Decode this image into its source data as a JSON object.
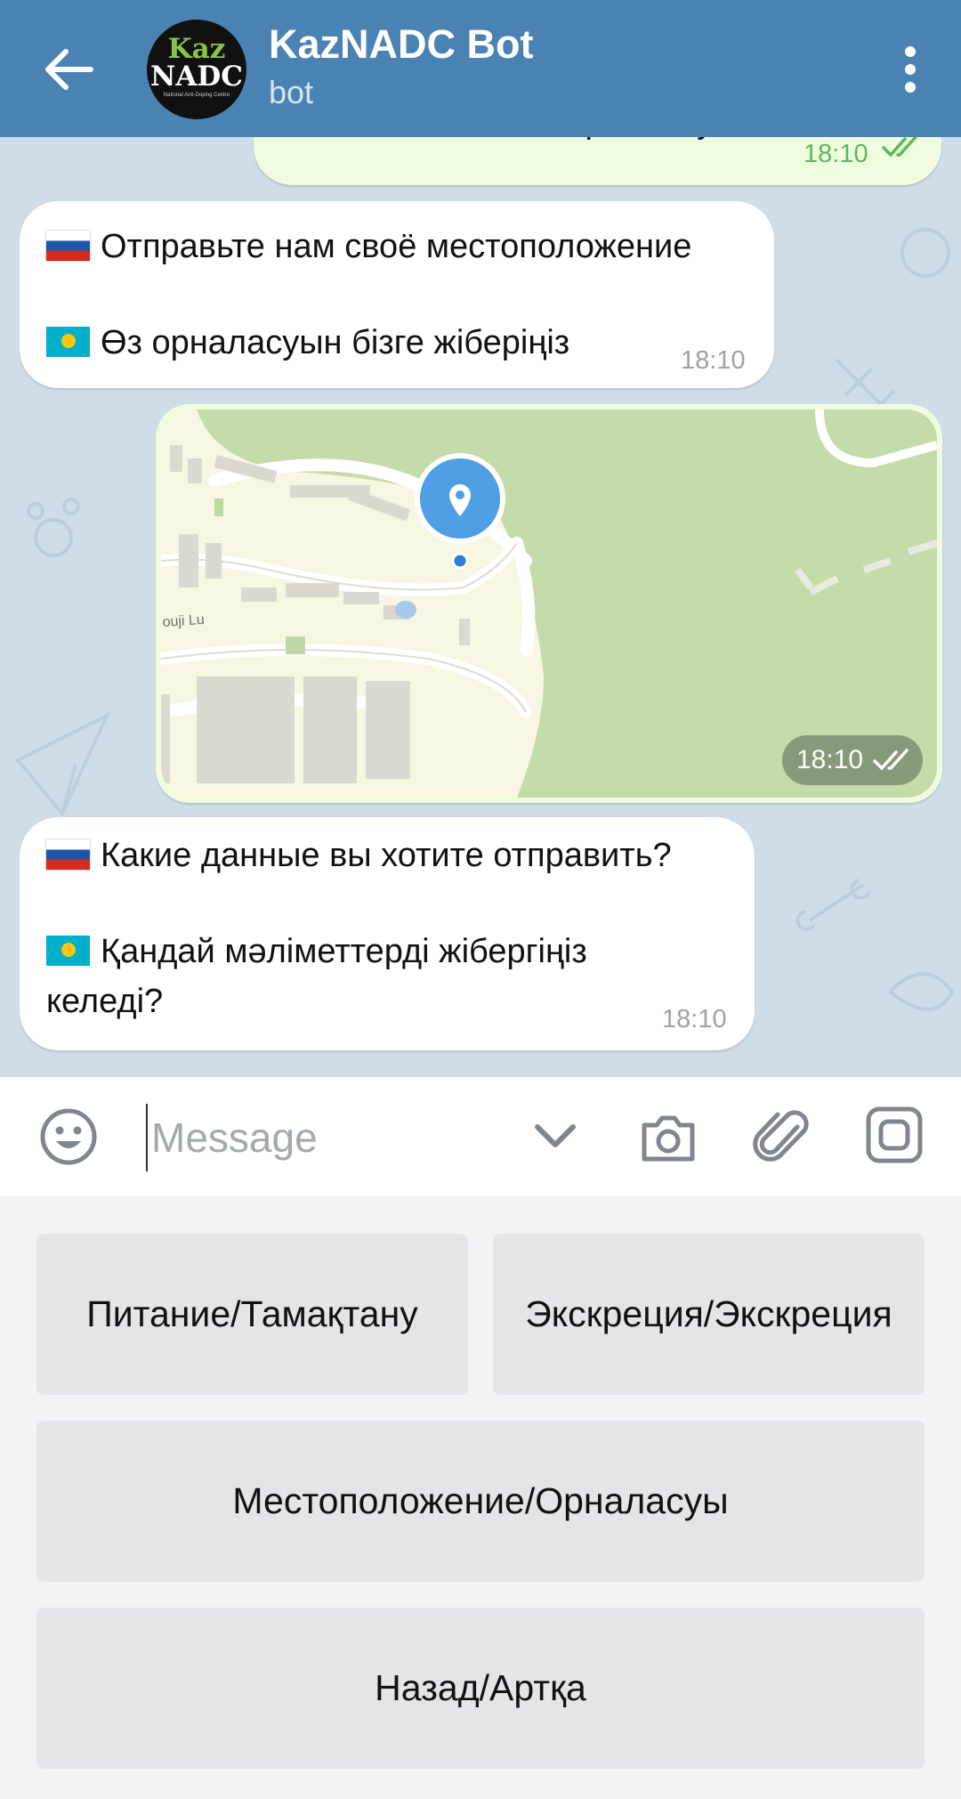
{
  "header": {
    "title": "KazNADC Bot",
    "subtitle": "bot",
    "avatar_line1": "Kaz",
    "avatar_line2": "NADC",
    "avatar_small": "National Anti-Doping Centre"
  },
  "messages": {
    "top_out": {
      "text": "Местоположение/Орналасуы",
      "time": "18:10"
    },
    "msg1": {
      "line_ru": "Отправьте нам своё местоположение",
      "line_kz": "Өз орналасуын бізге жіберіңіз",
      "time": "18:10"
    },
    "map": {
      "street_label": "ouji Lu",
      "time": "18:10"
    },
    "msg2": {
      "line_ru": "Какие данные вы хотите отправить?",
      "line_kz_1": "Қандай мәліметтерді жібергіңіз",
      "line_kz_2": "келеді?",
      "time": "18:10"
    }
  },
  "composer": {
    "placeholder": "Message"
  },
  "keyboard": {
    "btn_food": "Питание/Тамақтану",
    "btn_excretion": "Экскреция/Экскреция",
    "btn_location": "Местоположение/Орналасуы",
    "btn_back": "Назад/Артқа"
  },
  "colors": {
    "header": "#4a83b3",
    "chat_bg": "#cfdde9",
    "outgoing_bubble": "#effdde",
    "check_green": "#5cb85c",
    "pin_blue": "#4f9ee3"
  }
}
